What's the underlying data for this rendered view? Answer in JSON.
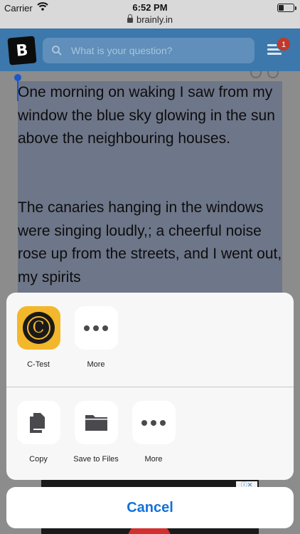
{
  "status_bar": {
    "carrier": "Carrier",
    "time": "6:52 PM",
    "wifi_icon": "wifi-icon",
    "battery_icon": "battery-icon"
  },
  "url_bar": {
    "domain": "brainly.in",
    "lock_icon": "lock-icon"
  },
  "header": {
    "logo_letter": "B",
    "search_placeholder": "What is your question?",
    "notification_count": "1",
    "accent": "#3c78ab"
  },
  "article": {
    "paragraph_1": "One morning on waking I saw from my window the blue sky glowing in the sun above the neighbouring houses.",
    "paragraph_2": "The canaries hanging in the windows were singing loudly,; a cheerful noise rose up from the streets, and I went out, my spirits"
  },
  "share_sheet": {
    "apps": [
      {
        "label": "C-Test",
        "icon": "c-test-app-icon"
      },
      {
        "label": "More",
        "icon": "more-icon"
      }
    ],
    "actions": [
      {
        "label": "Copy",
        "icon": "copy-icon"
      },
      {
        "label": "Save to Files",
        "icon": "folder-icon"
      },
      {
        "label": "More",
        "icon": "more-icon"
      }
    ],
    "cancel_label": "Cancel",
    "action_color": "#1272d9"
  }
}
